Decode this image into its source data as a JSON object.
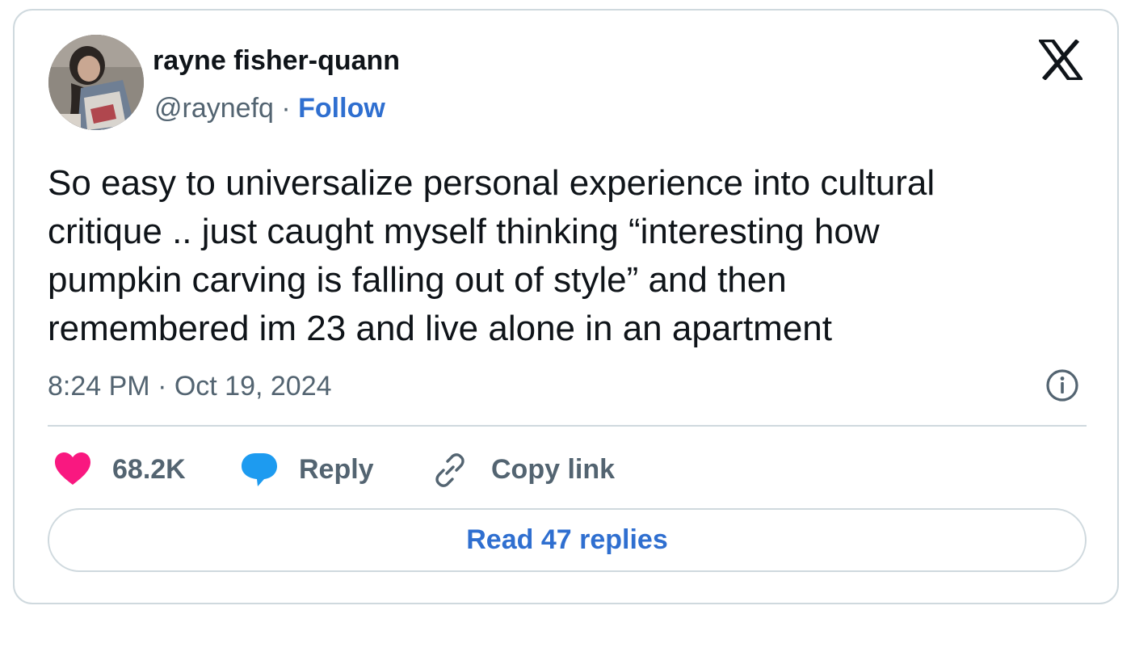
{
  "author": {
    "name": "rayne fisher-quann",
    "handle": "@raynefq",
    "separator": " · ",
    "follow_label": "Follow"
  },
  "tweet": {
    "lines": [
      "So easy to universalize personal experience into cultural",
      "critique .. just caught myself thinking “interesting how",
      "pumpkin carving is falling out of style” and then",
      "remembered im 23 and live alone in an apartment"
    ],
    "timestamp": "8:24 PM · Oct 19, 2024"
  },
  "actions": {
    "likes_count": "68.2K",
    "reply_label": "Reply",
    "copy_link_label": "Copy link"
  },
  "read_replies_label": "Read 47 replies",
  "icons": {
    "brand": "x-logo-icon",
    "info": "info-icon",
    "like": "heart-icon",
    "reply": "speech-bubble-icon",
    "copy": "link-icon"
  },
  "colors": {
    "accent": "#2f6fd0",
    "like": "#f91880",
    "reply_icon": "#1d9bf0",
    "muted_text": "#536471",
    "border": "#cfd9de"
  }
}
